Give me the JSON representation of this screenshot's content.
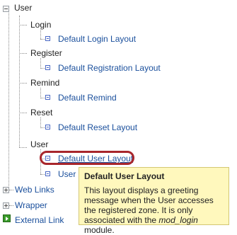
{
  "tree": {
    "root_label": "User",
    "groups": [
      {
        "label": "Login",
        "item": "Default Login Layout"
      },
      {
        "label": "Register",
        "item": "Default Registration Layout"
      },
      {
        "label": "Remind",
        "item": "Default Remind"
      },
      {
        "label": "Reset",
        "item": "Default Reset Layout"
      },
      {
        "label": "User",
        "items": [
          "Default User Layout",
          "User Profile"
        ]
      }
    ],
    "collapsed": [
      "Web Links",
      "Wrapper"
    ],
    "external_link": "External Link"
  },
  "tooltip": {
    "title": "Default User Layout",
    "body_prefix": "This layout displays a greeting message when the User accesses the registered zone. It is only associated with the ",
    "body_em": "mod_login",
    "body_suffix": " module."
  },
  "colors": {
    "link": "#1a4f9c",
    "highlight": "#a8262c",
    "tooltip_bg": "#fff8bd"
  }
}
